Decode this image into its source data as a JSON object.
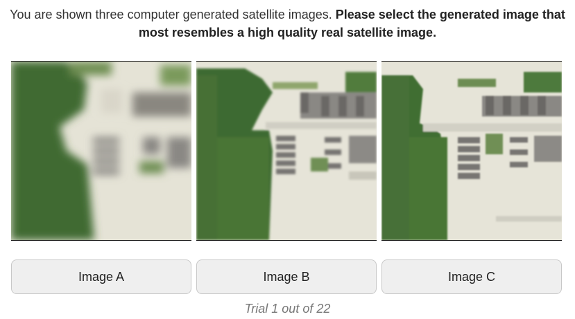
{
  "instructions": {
    "plain": "You are shown three computer generated satellite images. ",
    "bold": "Please select the generated image that most resembles a high quality real satellite image."
  },
  "images": [
    {
      "id": "A"
    },
    {
      "id": "B"
    },
    {
      "id": "C"
    }
  ],
  "buttons": {
    "a_label": "Image A",
    "b_label": "Image B",
    "c_label": "Image C"
  },
  "trial": {
    "text": "Trial 1 out of 22"
  },
  "colors": {
    "vegetation": "#3f6a32",
    "pavement": "#e6e4d8",
    "roof": "#7d7b78"
  }
}
